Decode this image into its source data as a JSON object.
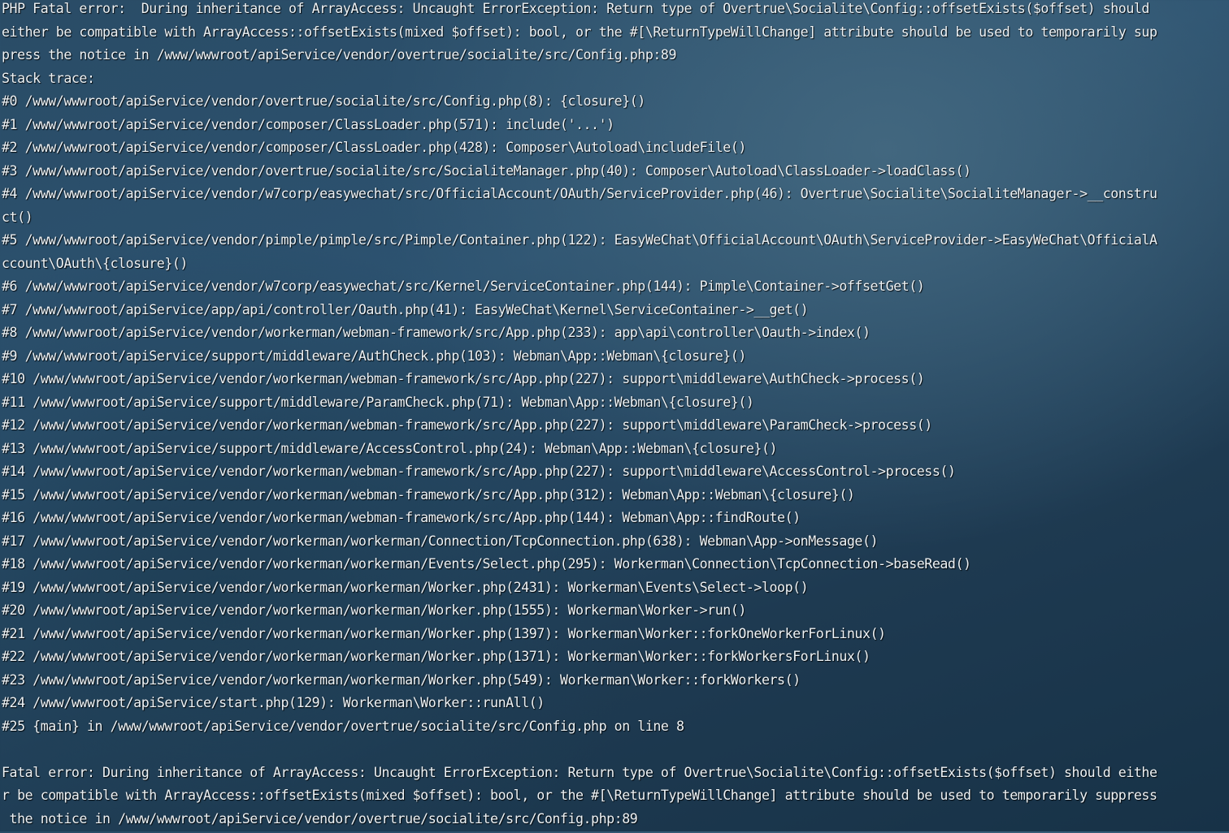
{
  "terminal": {
    "lines": [
      "PHP Fatal error:  During inheritance of ArrayAccess: Uncaught ErrorException: Return type of Overtrue\\Socialite\\Config::offsetExists($offset) should",
      "either be compatible with ArrayAccess::offsetExists(mixed $offset): bool, or the #[\\ReturnTypeWillChange] attribute should be used to temporarily sup",
      "press the notice in /www/wwwroot/apiService/vendor/overtrue/socialite/src/Config.php:89",
      "Stack trace:",
      "#0 /www/wwwroot/apiService/vendor/overtrue/socialite/src/Config.php(8): {closure}()",
      "#1 /www/wwwroot/apiService/vendor/composer/ClassLoader.php(571): include('...')",
      "#2 /www/wwwroot/apiService/vendor/composer/ClassLoader.php(428): Composer\\Autoload\\includeFile()",
      "#3 /www/wwwroot/apiService/vendor/overtrue/socialite/src/SocialiteManager.php(40): Composer\\Autoload\\ClassLoader->loadClass()",
      "#4 /www/wwwroot/apiService/vendor/w7corp/easywechat/src/OfficialAccount/OAuth/ServiceProvider.php(46): Overtrue\\Socialite\\SocialiteManager->__constru",
      "ct()",
      "#5 /www/wwwroot/apiService/vendor/pimple/pimple/src/Pimple/Container.php(122): EasyWeChat\\OfficialAccount\\OAuth\\ServiceProvider->EasyWeChat\\OfficialA",
      "ccount\\OAuth\\{closure}()",
      "#6 /www/wwwroot/apiService/vendor/w7corp/easywechat/src/Kernel/ServiceContainer.php(144): Pimple\\Container->offsetGet()",
      "#7 /www/wwwroot/apiService/app/api/controller/Oauth.php(41): EasyWeChat\\Kernel\\ServiceContainer->__get()",
      "#8 /www/wwwroot/apiService/vendor/workerman/webman-framework/src/App.php(233): app\\api\\controller\\Oauth->index()",
      "#9 /www/wwwroot/apiService/support/middleware/AuthCheck.php(103): Webman\\App::Webman\\{closure}()",
      "#10 /www/wwwroot/apiService/vendor/workerman/webman-framework/src/App.php(227): support\\middleware\\AuthCheck->process()",
      "#11 /www/wwwroot/apiService/support/middleware/ParamCheck.php(71): Webman\\App::Webman\\{closure}()",
      "#12 /www/wwwroot/apiService/vendor/workerman/webman-framework/src/App.php(227): support\\middleware\\ParamCheck->process()",
      "#13 /www/wwwroot/apiService/support/middleware/AccessControl.php(24): Webman\\App::Webman\\{closure}()",
      "#14 /www/wwwroot/apiService/vendor/workerman/webman-framework/src/App.php(227): support\\middleware\\AccessControl->process()",
      "#15 /www/wwwroot/apiService/vendor/workerman/webman-framework/src/App.php(312): Webman\\App::Webman\\{closure}()",
      "#16 /www/wwwroot/apiService/vendor/workerman/webman-framework/src/App.php(144): Webman\\App::findRoute()",
      "#17 /www/wwwroot/apiService/vendor/workerman/workerman/Connection/TcpConnection.php(638): Webman\\App->onMessage()",
      "#18 /www/wwwroot/apiService/vendor/workerman/workerman/Events/Select.php(295): Workerman\\Connection\\TcpConnection->baseRead()",
      "#19 /www/wwwroot/apiService/vendor/workerman/workerman/Worker.php(2431): Workerman\\Events\\Select->loop()",
      "#20 /www/wwwroot/apiService/vendor/workerman/workerman/Worker.php(1555): Workerman\\Worker->run()",
      "#21 /www/wwwroot/apiService/vendor/workerman/workerman/Worker.php(1397): Workerman\\Worker::forkOneWorkerForLinux()",
      "#22 /www/wwwroot/apiService/vendor/workerman/workerman/Worker.php(1371): Workerman\\Worker::forkWorkersForLinux()",
      "#23 /www/wwwroot/apiService/vendor/workerman/workerman/Worker.php(549): Workerman\\Worker::forkWorkers()",
      "#24 /www/wwwroot/apiService/start.php(129): Workerman\\Worker::runAll()",
      "#25 {main} in /www/wwwroot/apiService/vendor/overtrue/socialite/src/Config.php on line 8",
      "",
      "Fatal error: During inheritance of ArrayAccess: Uncaught ErrorException: Return type of Overtrue\\Socialite\\Config::offsetExists($offset) should eithe",
      "r be compatible with ArrayAccess::offsetExists(mixed $offset): bool, or the #[\\ReturnTypeWillChange] attribute should be used to temporarily suppress",
      " the notice in /www/wwwroot/apiService/vendor/overtrue/socialite/src/Config.php:89"
    ]
  }
}
